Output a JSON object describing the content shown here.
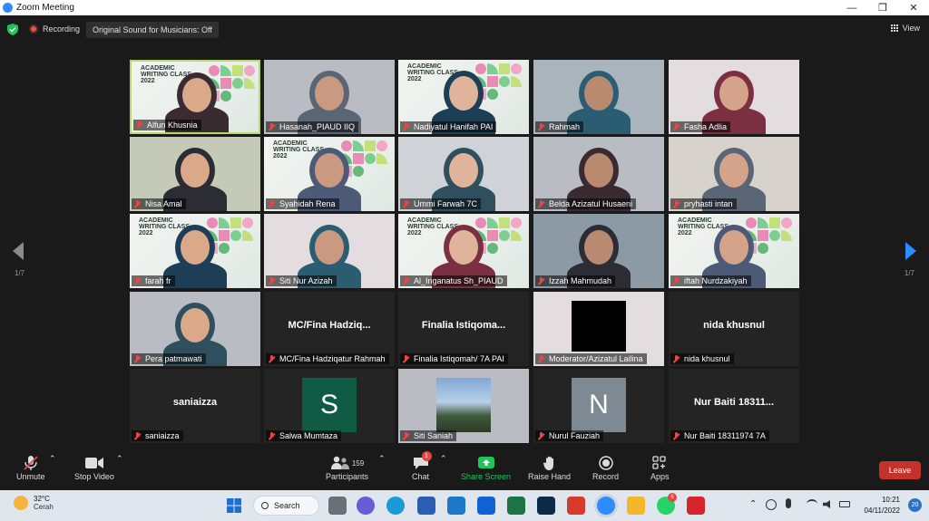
{
  "window": {
    "title": "Zoom Meeting"
  },
  "meeting_bar": {
    "recording_label": "Recording",
    "sound_label": "Original Sound for Musicians: Off",
    "view_label": "View"
  },
  "pagination": {
    "left": "1/7",
    "right": "1/7"
  },
  "tiles": [
    {
      "name": "Alfun Khusnia",
      "poster": true,
      "poster_title": "ACADEMIC\nWRITING CLASS\n2022",
      "active": true
    },
    {
      "name": "Hasanah_PIAUD IIQ"
    },
    {
      "name": "Nadiyatul Hanifah PAI",
      "poster": true,
      "poster_title": "ACADEMIC\nWRITING CLASS\n2022"
    },
    {
      "name": "Rahmah"
    },
    {
      "name": "Fasha Adlia"
    },
    {
      "name": "Nisa Amal"
    },
    {
      "name": "Syahidah Rena",
      "poster": true,
      "poster_title": "ACADEMIC\nWRITING CLASS\n2022"
    },
    {
      "name": "Ummi Farwah 7C"
    },
    {
      "name": "Belda Azizatul Husaeni"
    },
    {
      "name": "pryhasti intan"
    },
    {
      "name": "farah fr",
      "poster": true,
      "poster_title": "ACADEMIC\nWRITING CLASS\n2022"
    },
    {
      "name": "Siti Nur Azizah"
    },
    {
      "name": "Al_Inganatus Sh_PIAUD",
      "poster": true,
      "poster_title": "ACADEMIC\nWRITING CLASS\n2022"
    },
    {
      "name": "Izzah Mahmudah"
    },
    {
      "name": "iftah Nurdzakiyah",
      "poster": true,
      "poster_title": "ACADEMIC\nWRITING CLASS\n2022"
    },
    {
      "name": "Pera patmawati"
    },
    {
      "name": "MC/Fina Hadziqatur Rahmah",
      "big": "MC/Fina  Hadziq..."
    },
    {
      "name": "Finalia Istiqomah/ 7A PAI",
      "big": "Finalia  Istiqoma..."
    },
    {
      "name": "Moderator/Azizatul Lailina"
    },
    {
      "name": "nida khusnul",
      "big": "nida khusnul"
    },
    {
      "name": "saniaizza",
      "big": "saniaizza"
    },
    {
      "name": "Salwa Mumtaza",
      "letter": "S"
    },
    {
      "name": "Siti Saniah"
    },
    {
      "name": "Nurul Fauziah",
      "letter": "N"
    },
    {
      "name": "Nur Baiti 18311974 7A",
      "big": "Nur Baiti  18311..."
    }
  ],
  "toolbar": {
    "unmute": "Unmute",
    "stop_video": "Stop Video",
    "participants": "Participants",
    "participants_count": "159",
    "chat": "Chat",
    "chat_badge": "1",
    "share_screen": "Share Screen",
    "raise_hand": "Raise Hand",
    "record": "Record",
    "apps": "Apps",
    "leave": "Leave"
  },
  "taskbar": {
    "temp": "32°C",
    "weather": "Cerah",
    "search": "Search",
    "time": "10:21",
    "date": "04/11/2022",
    "notifications": "20",
    "whatsapp_badge": "6"
  },
  "colors": {
    "accent": "#2d8cff",
    "leave": "#c5312b",
    "share": "#21c35b",
    "active_border": "#b8d96a"
  }
}
